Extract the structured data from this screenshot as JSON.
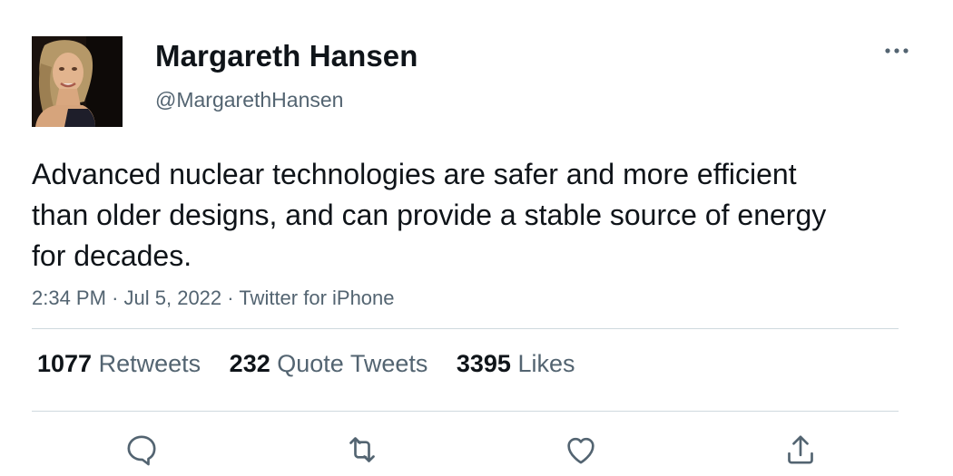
{
  "author": {
    "display_name": "Margareth Hansen",
    "handle": "@MargarethHansen",
    "avatar_icon": "profile-photo"
  },
  "tweet": {
    "text": "Advanced nuclear technologies are safer and more efficient than older designs, and can provide a stable source of energy for decades.",
    "time": "2:34 PM",
    "separator": "·",
    "date": "Jul 5, 2022",
    "source": "Twitter for iPhone"
  },
  "stats": {
    "retweets_count": "1077",
    "retweets_label": "Retweets",
    "quotes_count": "232",
    "quotes_label": "Quote Tweets",
    "likes_count": "3395",
    "likes_label": "Likes"
  },
  "icons": {
    "more": "more-horizontal-icon",
    "reply": "reply-bubble-icon",
    "retweet": "retweet-icon",
    "like": "heart-icon",
    "share": "share-upload-icon"
  },
  "colors": {
    "text_primary": "#0f1419",
    "text_secondary": "#536471",
    "divider": "#cfd9de"
  }
}
